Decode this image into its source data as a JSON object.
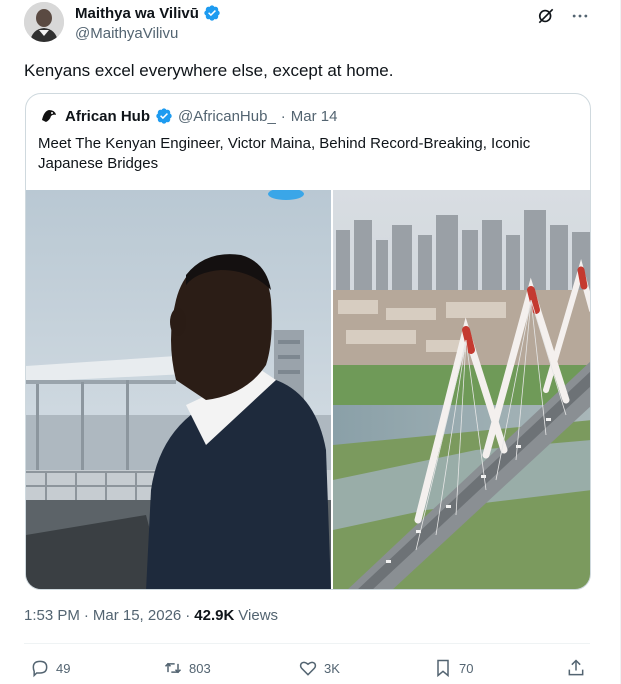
{
  "author": {
    "display_name": "Maithya wa Vilivū",
    "handle": "@MaithyaVilivu",
    "verified_icon": "verified-badge-icon"
  },
  "tweet": {
    "text": "Kenyans excel everywhere else, except at home."
  },
  "quote": {
    "display_name": "African Hub",
    "handle": "@AfricanHub_",
    "separator": "·",
    "date": "Mar 14",
    "text": "Meet The Kenyan Engineer, Victor Maina, Behind Record-Breaking, Iconic Japanese Bridges"
  },
  "meta": {
    "time": "1:53 PM",
    "separator": "·",
    "date": "Mar 15, 2026",
    "separator2": "·",
    "views_count": "42.9K",
    "views_label": "Views"
  },
  "actions": {
    "replies": "49",
    "reposts": "803",
    "likes": "3K",
    "bookmarks": "70"
  },
  "colors": {
    "accent": "#1d9bf0",
    "muted_text": "#536471",
    "border": "#cfd9de"
  }
}
